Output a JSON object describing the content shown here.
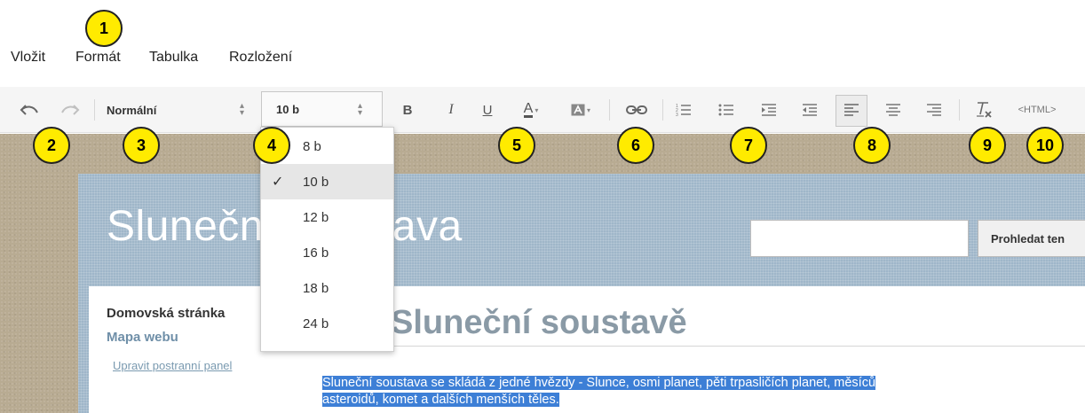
{
  "menu": [
    "Vložit",
    "Formát",
    "Tabulka",
    "Rozložení"
  ],
  "toolbar": {
    "style_select": "Normální",
    "size_select": "10 b",
    "html_label": "<HTML>",
    "bold": "B",
    "italic": "I",
    "underline": "U",
    "font_color": "A"
  },
  "size_options": [
    "8 b",
    "10 b",
    "12 b",
    "16 b",
    "18 b",
    "24 b"
  ],
  "selected_size": "10 b",
  "site": {
    "title": "Sluneční soustava",
    "search_button": "Prohledat ten",
    "nav_home": "Domovská stránka",
    "nav_map": "Mapa webu",
    "nav_edit": "Upravit postranní panel",
    "heading": "Sluneční soustavě",
    "text_line1": "Sluneční soustava se skládá z jedné hvězdy - Slunce, osmi planet, pěti trpasličích planet, měsíců",
    "text_line2": "asteroidů, komet a dalších menších těles."
  },
  "badges": [
    "1",
    "2",
    "3",
    "4",
    "5",
    "6",
    "7",
    "8",
    "9",
    "10"
  ],
  "colors": {
    "badge": "#ffeb00",
    "selection": "#3d7fd6",
    "site_header": "#9fb6c9",
    "background_texture": "#b8ab92"
  }
}
